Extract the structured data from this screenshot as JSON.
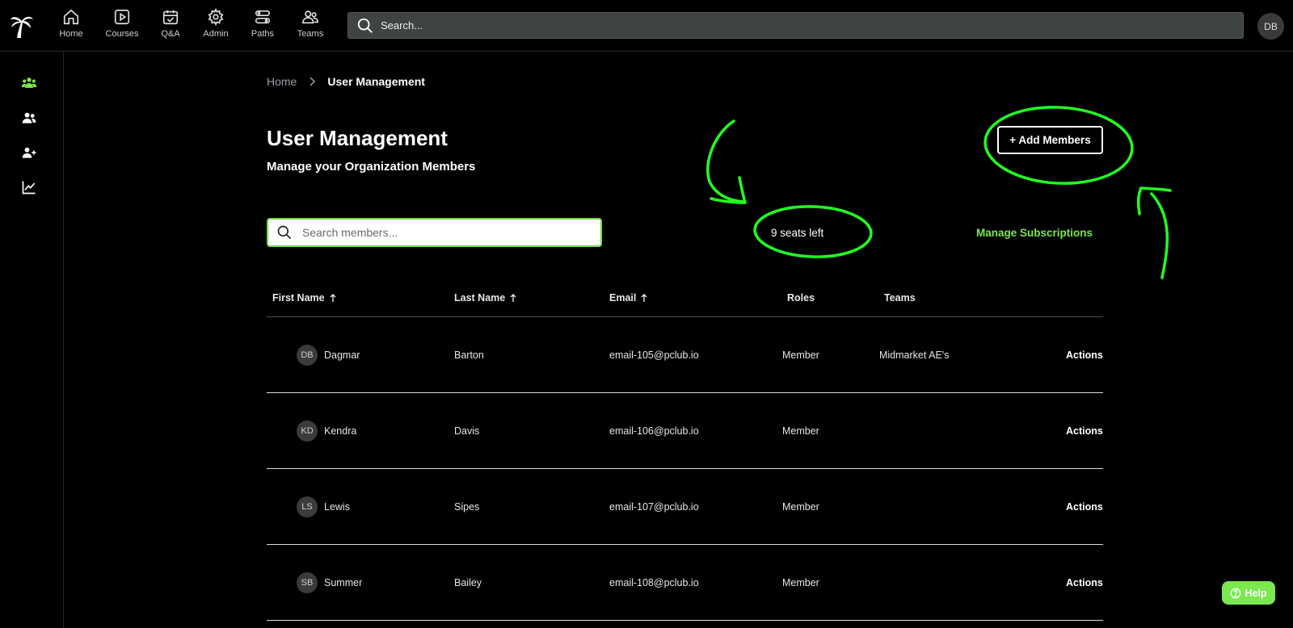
{
  "nav": {
    "items": [
      {
        "label": "Home",
        "icon": "home-icon"
      },
      {
        "label": "Courses",
        "icon": "play-icon"
      },
      {
        "label": "Q&A",
        "icon": "calendar-check-icon"
      },
      {
        "label": "Admin",
        "icon": "gear-icon"
      },
      {
        "label": "Paths",
        "icon": "paths-icon"
      },
      {
        "label": "Teams",
        "icon": "users-icon"
      }
    ],
    "search_placeholder": "Search...",
    "user_initials": "DB"
  },
  "sidebar": {
    "items": [
      {
        "icon": "organization-icon",
        "active": true
      },
      {
        "icon": "users-icon"
      },
      {
        "icon": "add-user-icon"
      },
      {
        "icon": "chart-line-icon"
      }
    ]
  },
  "breadcrumb": {
    "home": "Home",
    "current": "User Management"
  },
  "header": {
    "title": "User Management",
    "subtitle": "Manage your Organization Members",
    "add_button": "+ Add Members"
  },
  "toolbar": {
    "search_placeholder": "Search members...",
    "seats_left": "9 seats left",
    "manage_subscriptions": "Manage Subscriptions"
  },
  "table": {
    "columns": {
      "first_name": "First Name",
      "last_name": "Last Name",
      "email": "Email",
      "roles": "Roles",
      "teams": "Teams"
    },
    "rows": [
      {
        "initials": "DB",
        "first": "Dagmar",
        "last": "Barton",
        "email": "email-105@pclub.io",
        "role": "Member",
        "team": "Midmarket AE's",
        "action": "Actions"
      },
      {
        "initials": "KD",
        "first": "Kendra",
        "last": "Davis",
        "email": "email-106@pclub.io",
        "role": "Member",
        "team": "",
        "action": "Actions"
      },
      {
        "initials": "LS",
        "first": "Lewis",
        "last": "Sipes",
        "email": "email-107@pclub.io",
        "role": "Member",
        "team": "",
        "action": "Actions"
      },
      {
        "initials": "SB",
        "first": "Summer",
        "last": "Bailey",
        "email": "email-108@pclub.io",
        "role": "Member",
        "team": "",
        "action": "Actions"
      }
    ]
  },
  "help": {
    "label": "Help"
  },
  "colors": {
    "accent": "#7be84f",
    "annotation": "#22ff22"
  }
}
